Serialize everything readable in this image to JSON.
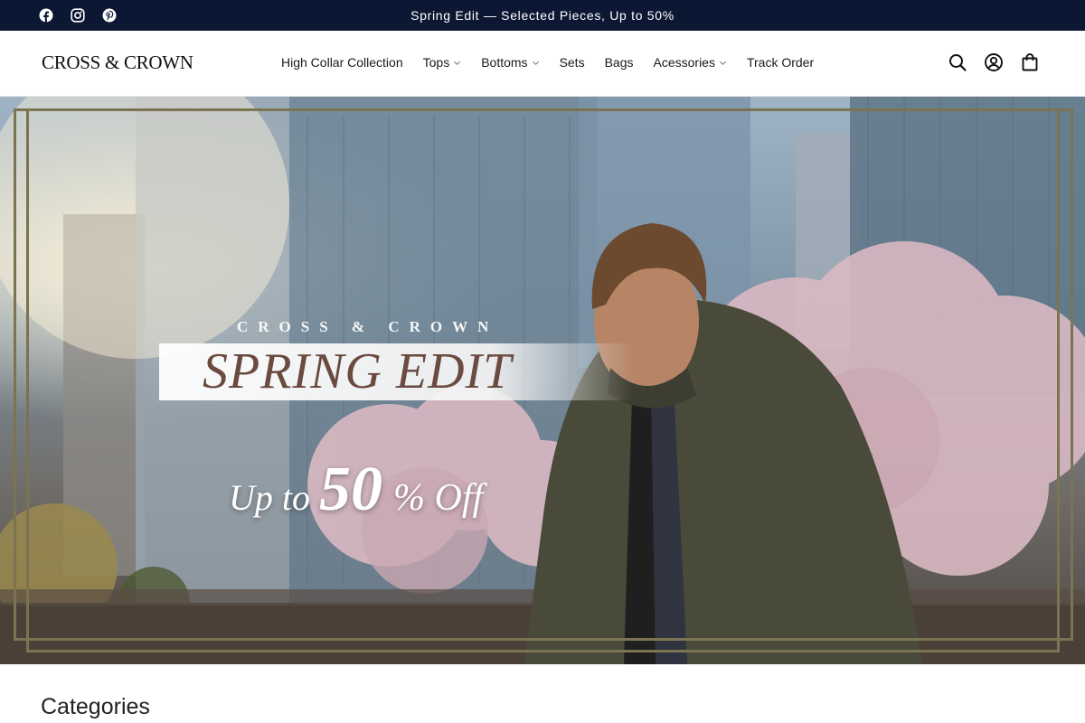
{
  "announcement": {
    "text": "Spring Edit — Selected Pieces, Up to 50%",
    "social_icons": [
      "facebook-icon",
      "instagram-icon",
      "pinterest-icon"
    ]
  },
  "header": {
    "logo": "CROSS & CROWN",
    "nav": [
      {
        "label": "High Collar Collection",
        "dropdown": false
      },
      {
        "label": "Tops",
        "dropdown": true
      },
      {
        "label": "Bottoms",
        "dropdown": true
      },
      {
        "label": "Sets",
        "dropdown": false
      },
      {
        "label": "Bags",
        "dropdown": false
      },
      {
        "label": "Acessories",
        "dropdown": true
      },
      {
        "label": "Track Order",
        "dropdown": false
      }
    ],
    "icons": [
      "search-icon",
      "account-icon",
      "cart-icon"
    ]
  },
  "hero": {
    "brand": "CROSS & CROWN",
    "title": "SPRING EDIT",
    "offer_prefix": "Up to",
    "offer_number": "50",
    "offer_suffix": "% Off"
  },
  "sections": {
    "categories_title": "Categories"
  },
  "colors": {
    "announcement_bg": "#0b1733",
    "frame": "#7b7352",
    "title_text": "#6b4a40"
  }
}
